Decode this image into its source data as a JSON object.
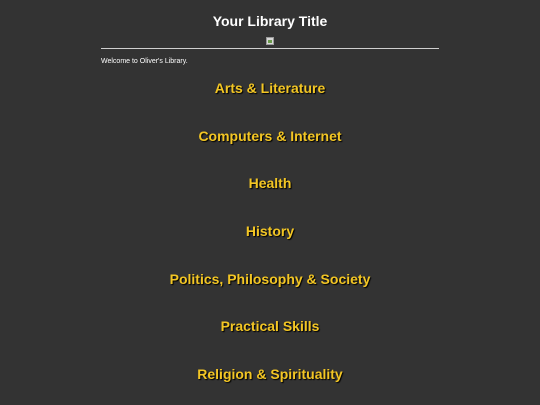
{
  "header": {
    "title": "Your Library Title"
  },
  "welcome_text": "Welcome to Oliver's Library.",
  "colors": {
    "background": "#333333",
    "link": "#f3c624",
    "title": "#ffffff"
  },
  "categories": [
    {
      "label": "Arts & Literature"
    },
    {
      "label": "Computers & Internet"
    },
    {
      "label": "Health"
    },
    {
      "label": "History"
    },
    {
      "label": "Politics, Philosophy & Society"
    },
    {
      "label": "Practical Skills"
    },
    {
      "label": "Religion & Spirituality"
    }
  ]
}
